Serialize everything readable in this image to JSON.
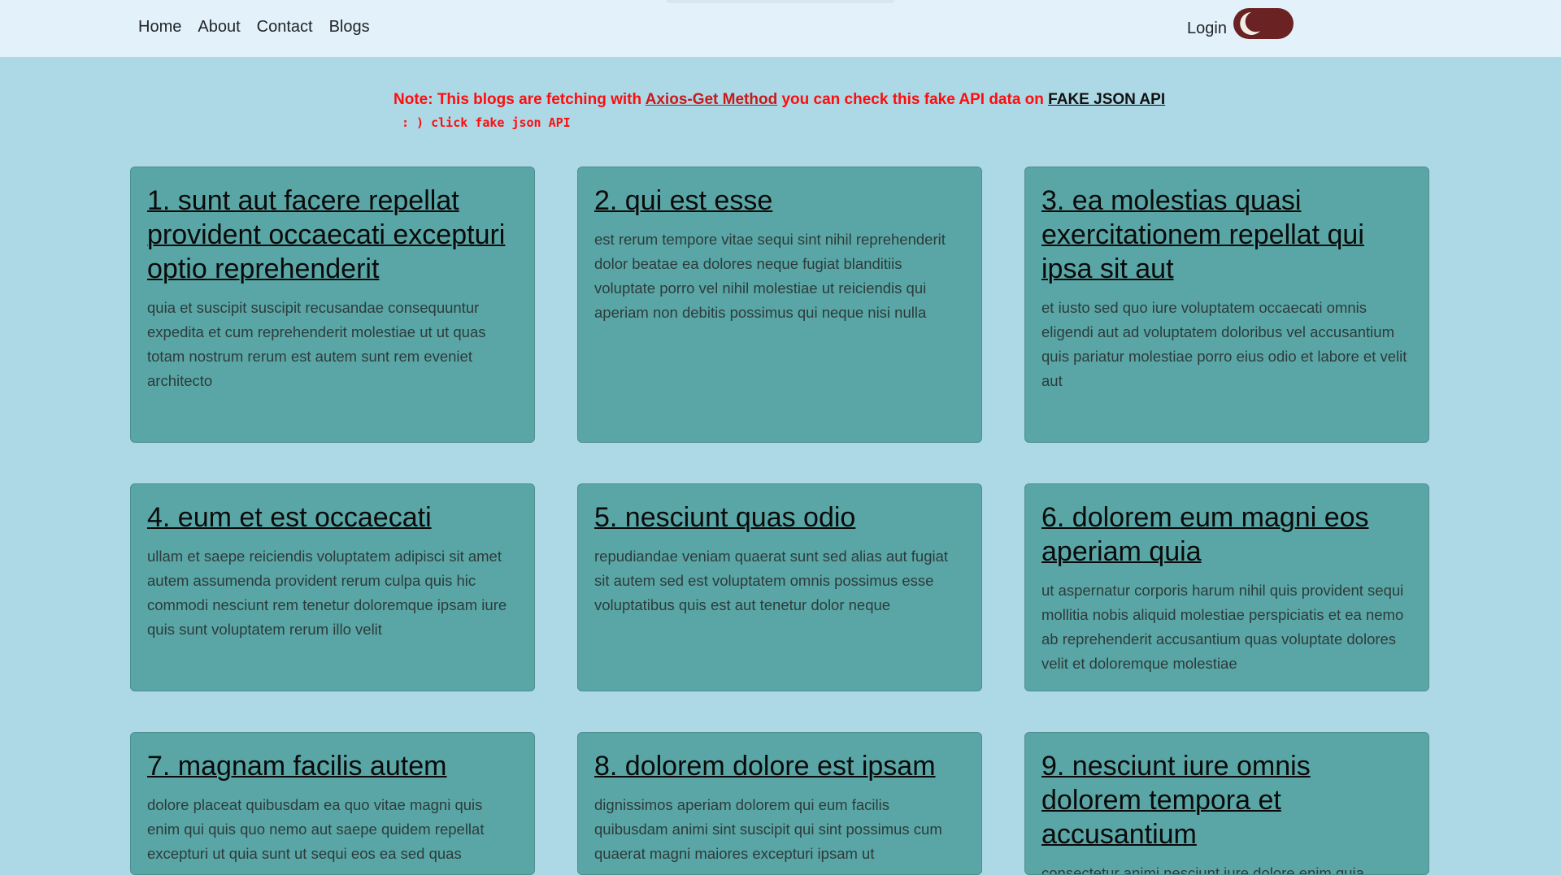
{
  "nav": {
    "links": [
      "Home",
      "About",
      "Contact",
      "Blogs"
    ],
    "login": "Login"
  },
  "note": {
    "prefix": "Note: This blogs are fetching with ",
    "method_link": "Axios-Get Method",
    "middle": " you can check this fake API data on ",
    "api_link": "FAKE JSON API",
    "sub": ": ) click fake json API"
  },
  "posts": [
    {
      "title": "1. sunt aut facere repellat provident occaecati excepturi optio reprehenderit",
      "body": "quia et suscipit suscipit recusandae consequuntur expedita et cum reprehenderit molestiae ut ut quas totam nostrum rerum est autem sunt rem eveniet architecto"
    },
    {
      "title": "2. qui est esse",
      "body": "est rerum tempore vitae sequi sint nihil reprehenderit dolor beatae ea dolores neque fugiat blanditiis voluptate porro vel nihil molestiae ut reiciendis qui aperiam non debitis possimus qui neque nisi nulla"
    },
    {
      "title": "3. ea molestias quasi exercitationem repellat qui ipsa sit aut",
      "body": "et iusto sed quo iure voluptatem occaecati omnis eligendi aut ad voluptatem doloribus vel accusantium quis pariatur molestiae porro eius odio et labore et velit aut"
    },
    {
      "title": "4. eum et est occaecati",
      "body": "ullam et saepe reiciendis voluptatem adipisci sit amet autem assumenda provident rerum culpa quis hic commodi nesciunt rem tenetur doloremque ipsam iure quis sunt voluptatem rerum illo velit"
    },
    {
      "title": "5. nesciunt quas odio",
      "body": "repudiandae veniam quaerat sunt sed alias aut fugiat sit autem sed est voluptatem omnis possimus esse voluptatibus quis est aut tenetur dolor neque"
    },
    {
      "title": "6. dolorem eum magni eos aperiam quia",
      "body": "ut aspernatur corporis harum nihil quis provident sequi mollitia nobis aliquid molestiae perspiciatis et ea nemo ab reprehenderit accusantium quas voluptate dolores velit et doloremque molestiae"
    },
    {
      "title": "7. magnam facilis autem",
      "body": "dolore placeat quibusdam ea quo vitae magni quis enim qui quis quo nemo aut saepe quidem repellat excepturi ut quia sunt ut sequi eos ea sed quas"
    },
    {
      "title": "8. dolorem dolore est ipsam",
      "body": "dignissimos aperiam dolorem qui eum facilis quibusdam animi sint suscipit qui sint possimus cum quaerat magni maiores excepturi ipsam ut"
    },
    {
      "title": "9. nesciunt iure omnis dolorem tempora et accusantium",
      "body": "consectetur animi nesciunt iure dolore enim quia"
    }
  ],
  "theme": {
    "accent": "#6a2222",
    "card_bg": "#5aa6a6",
    "page_bg": "#add8e6",
    "note_color": "#ff0d0d"
  }
}
